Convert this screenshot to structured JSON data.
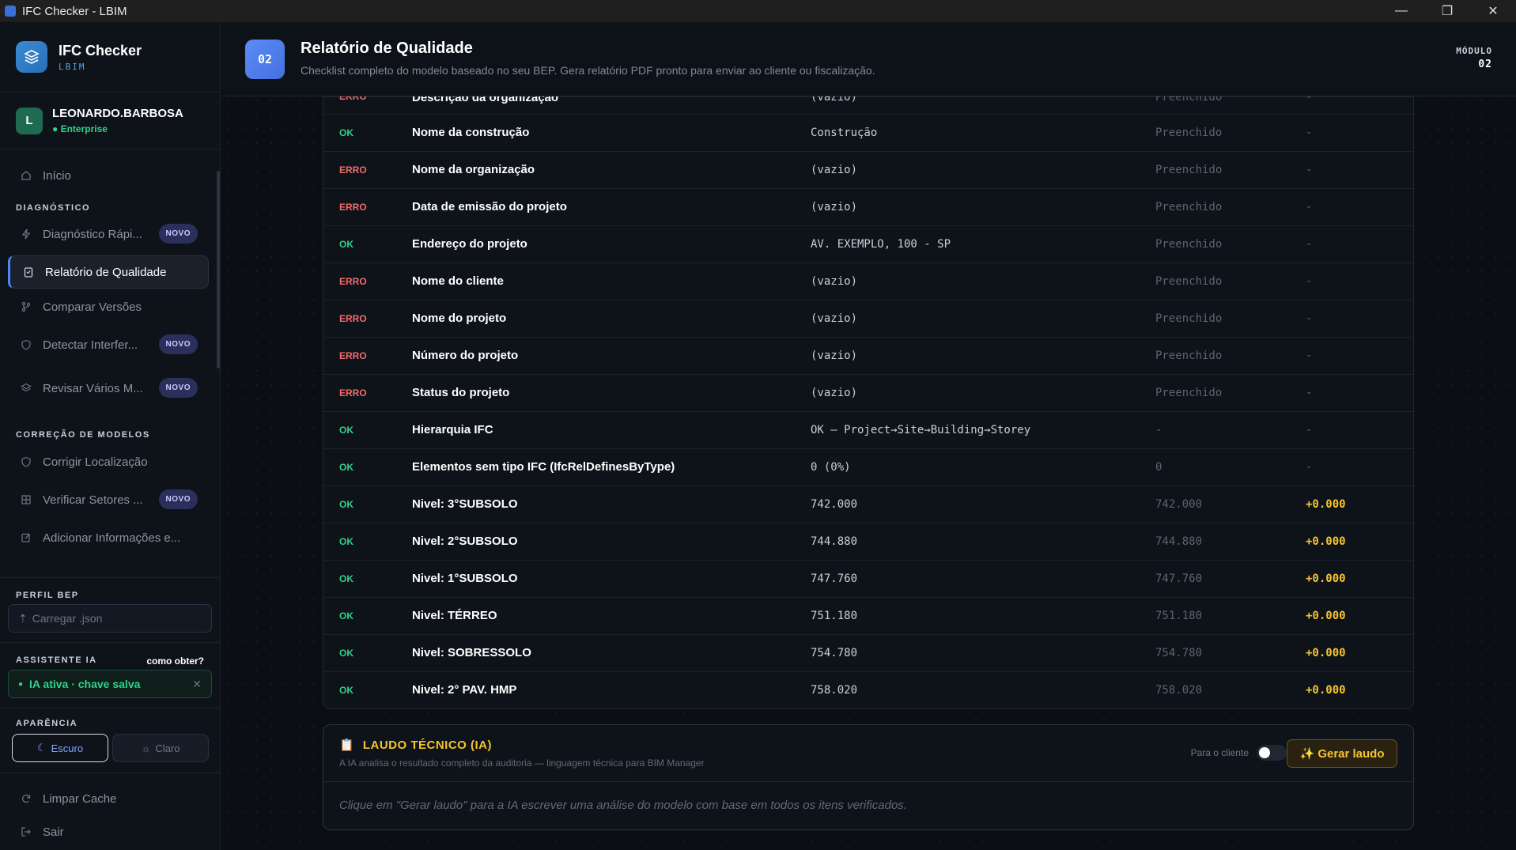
{
  "window": {
    "title": "IFC Checker - LBIM",
    "minimize": "—",
    "maximize": "❐",
    "close": "✕"
  },
  "brand": {
    "name": "IFC Checker",
    "sub": "LBIM"
  },
  "user": {
    "initial": "L",
    "name": "LEONARDO.BARBOSA",
    "plan": "● Enterprise"
  },
  "nav": {
    "home": "Início",
    "diag_header": "DIAGNÓSTICO",
    "diag_items": [
      {
        "label": "Diagnóstico Rápi...",
        "badge": "NOVO",
        "icon": "zap-icon"
      },
      {
        "label": "Relatório de Qualidade",
        "badge": "",
        "icon": "clipboard-icon"
      },
      {
        "label": "Comparar Versões",
        "badge": "",
        "icon": "branch-icon"
      },
      {
        "label": "Detectar Interfer...",
        "badge": "NOVO",
        "icon": "shield-icon"
      },
      {
        "label": "Revisar Vários M...",
        "badge": "NOVO",
        "icon": "layers-icon"
      }
    ],
    "corr_header": "CORREÇÃO DE MODELOS",
    "corr_items": [
      {
        "label": "Corrigir Localização",
        "badge": "",
        "icon": "shield-icon"
      },
      {
        "label": "Verificar Setores ...",
        "badge": "NOVO",
        "icon": "grid-icon"
      },
      {
        "label": "Adicionar Informações e...",
        "badge": "",
        "icon": "edit-icon"
      }
    ],
    "bep_header": "PERFIL BEP",
    "bep_upload": "Carregar .json",
    "ia_header": "ASSISTENTE IA",
    "ia_how": "como obter?",
    "ia_status": "IA ativa · chave salva",
    "appearance_header": "APARÊNCIA",
    "theme_dark": "Escuro",
    "theme_light": "Claro",
    "clear_cache": "Limpar Cache",
    "logout": "Sair"
  },
  "header": {
    "number": "02",
    "title": "Relatório de Qualidade",
    "description": "Checklist completo do modelo baseado no seu BEP. Gera relatório PDF pronto para enviar ao cliente ou fiscalização.",
    "module_label": "MÓDULO",
    "module_number": "02"
  },
  "rows": [
    {
      "status": "ERRO",
      "name": "Descrição da organização",
      "value": "(vazio)",
      "expected": "Preenchido",
      "diff": "-"
    },
    {
      "status": "OK",
      "name": "Nome da construção",
      "value": "Construção",
      "expected": "Preenchido",
      "diff": "-"
    },
    {
      "status": "ERRO",
      "name": "Nome da organização",
      "value": "(vazio)",
      "expected": "Preenchido",
      "diff": "-"
    },
    {
      "status": "ERRO",
      "name": "Data de emissão do projeto",
      "value": "(vazio)",
      "expected": "Preenchido",
      "diff": "-"
    },
    {
      "status": "OK",
      "name": "Endereço do projeto",
      "value": "AV. EXEMPLO, 100 - SP",
      "expected": "Preenchido",
      "diff": "-"
    },
    {
      "status": "ERRO",
      "name": "Nome do cliente",
      "value": "(vazio)",
      "expected": "Preenchido",
      "diff": "-"
    },
    {
      "status": "ERRO",
      "name": "Nome do projeto",
      "value": "(vazio)",
      "expected": "Preenchido",
      "diff": "-"
    },
    {
      "status": "ERRO",
      "name": "Número do projeto",
      "value": "(vazio)",
      "expected": "Preenchido",
      "diff": "-"
    },
    {
      "status": "ERRO",
      "name": "Status do projeto",
      "value": "(vazio)",
      "expected": "Preenchido",
      "diff": "-"
    },
    {
      "status": "OK",
      "name": "Hierarquia IFC",
      "value": "OK — Project→Site→Building→Storey",
      "expected": "-",
      "diff": "-"
    },
    {
      "status": "OK",
      "name": "Elementos sem tipo IFC (IfcRelDefinesByType)",
      "value": "0 (0%)",
      "expected": "0",
      "diff": "-"
    },
    {
      "status": "OK",
      "name": "Nivel: 3°SUBSOLO",
      "value": "742.000",
      "expected": "742.000",
      "diff": "+0.000"
    },
    {
      "status": "OK",
      "name": "Nivel: 2°SUBSOLO",
      "value": "744.880",
      "expected": "744.880",
      "diff": "+0.000"
    },
    {
      "status": "OK",
      "name": "Nivel: 1°SUBSOLO",
      "value": "747.760",
      "expected": "747.760",
      "diff": "+0.000"
    },
    {
      "status": "OK",
      "name": "Nivel: TÉRREO",
      "value": "751.180",
      "expected": "751.180",
      "diff": "+0.000"
    },
    {
      "status": "OK",
      "name": "Nivel: SOBRESSOLO",
      "value": "754.780",
      "expected": "754.780",
      "diff": "+0.000"
    },
    {
      "status": "OK",
      "name": "Nivel: 2° PAV. HMP",
      "value": "758.020",
      "expected": "758.020",
      "diff": "+0.000"
    }
  ],
  "laudo": {
    "title": "LAUDO TÉCNICO (IA)",
    "subtitle": "A IA analisa o resultado completo da auditoria — linguagem técnica para BIM Manager",
    "client_label": "Para o cliente",
    "generate": "✨ Gerar laudo",
    "hint": "Clique em \"Gerar laudo\" para a IA escrever uma análise do modelo com base em todos os itens verificados."
  }
}
